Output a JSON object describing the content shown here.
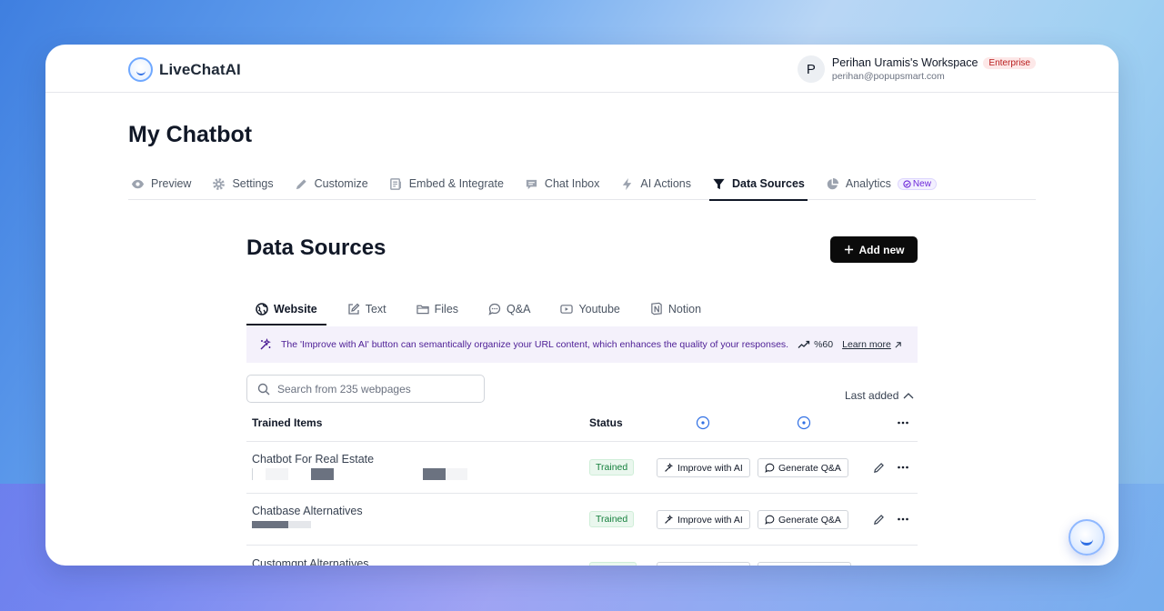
{
  "app": {
    "name": "LiveChatAI"
  },
  "account": {
    "avatar_letter": "P",
    "workspace": "Perihan Uramis's Workspace",
    "plan": "Enterprise",
    "email": "perihan@popupsmart.com"
  },
  "page": {
    "title": "My Chatbot"
  },
  "nav": {
    "items": [
      {
        "label": "Preview",
        "icon": "eye-icon"
      },
      {
        "label": "Settings",
        "icon": "gear-icon"
      },
      {
        "label": "Customize",
        "icon": "pencil-icon"
      },
      {
        "label": "Embed & Integrate",
        "icon": "embed-icon"
      },
      {
        "label": "Chat Inbox",
        "icon": "chat-icon"
      },
      {
        "label": "AI Actions",
        "icon": "bolt-icon"
      },
      {
        "label": "Data Sources",
        "icon": "funnel-icon",
        "active": true
      },
      {
        "label": "Analytics",
        "icon": "pie-icon",
        "badge": "New"
      }
    ]
  },
  "data_sources": {
    "title": "Data Sources",
    "add_label": "Add new",
    "tabs": [
      {
        "label": "Website",
        "icon": "globe-icon",
        "active": true
      },
      {
        "label": "Text",
        "icon": "edit-icon"
      },
      {
        "label": "Files",
        "icon": "folder-icon"
      },
      {
        "label": "Q&A",
        "icon": "speech-icon"
      },
      {
        "label": "Youtube",
        "icon": "play-icon"
      },
      {
        "label": "Notion",
        "icon": "notion-icon"
      }
    ],
    "banner": {
      "text": "The 'Improve with AI' button can semantically organize your URL content, which enhances the quality of your responses.",
      "stat": "%60",
      "link": "Learn more"
    },
    "search_placeholder": "Search from 235 webpages",
    "sort_label": "Last added",
    "table": {
      "col_trained": "Trained Items",
      "col_status": "Status",
      "rows": [
        {
          "title": "Chatbot For Real Estate",
          "status": "Trained",
          "improve": "Improve with AI",
          "generate": "Generate Q&A"
        },
        {
          "title": "Chatbase Alternatives",
          "status": "Trained",
          "improve": "Improve with AI",
          "generate": "Generate Q&A"
        },
        {
          "title": "Customgpt Alternatives"
        }
      ]
    }
  },
  "colors": {
    "accent": "#111827",
    "trained_green": "#15803d",
    "enterprise_red": "#b91c1c"
  }
}
